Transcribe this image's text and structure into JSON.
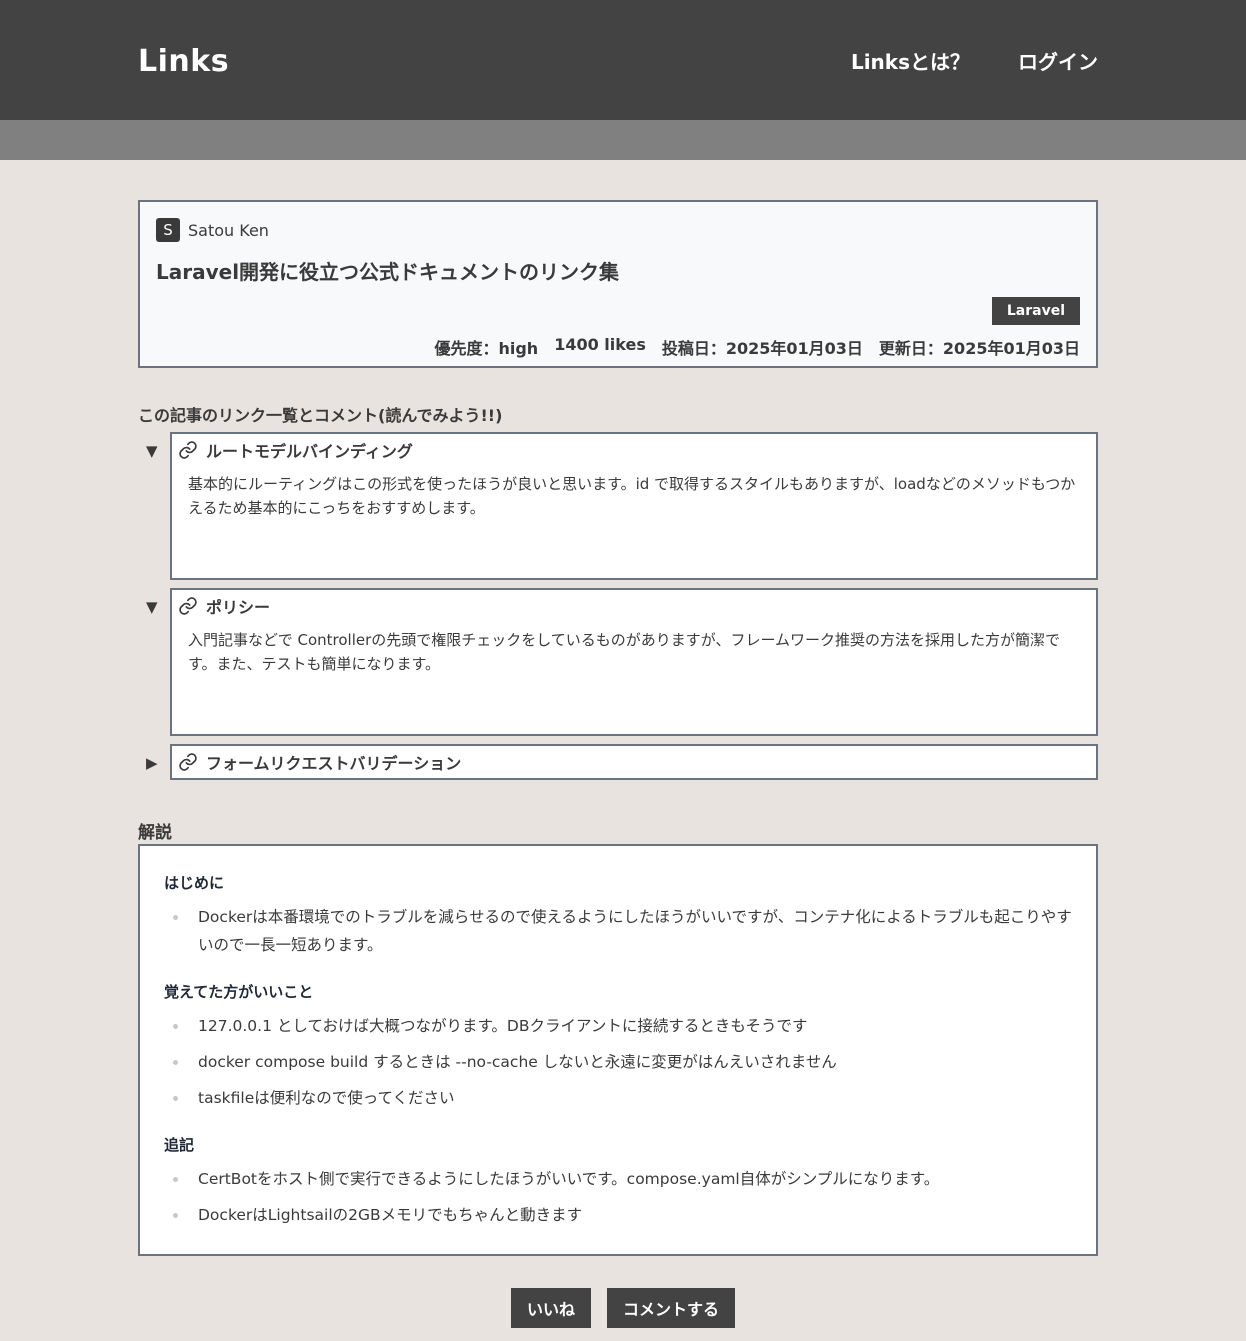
{
  "header": {
    "logo": "Links",
    "nav": {
      "about": "Linksとは？",
      "login": "ログイン"
    }
  },
  "article": {
    "author_initial": "S",
    "author_name": "Satou Ken",
    "title": "Laravel開発に役立つ公式ドキュメントのリンク集",
    "tag": "Laravel",
    "priority": "優先度：high",
    "likes": "1400 likes",
    "posted": "投稿日：2025年01月03日",
    "updated": "更新日：2025年01月03日"
  },
  "links_section": {
    "heading": "この記事のリンク一覧とコメント(読んでみよう!!)",
    "items": [
      {
        "toggle": "▼",
        "title": "ルートモデルバインディング",
        "comment": "基本的にルーティングはこの形式を使ったほうが良いと思います。id で取得するスタイルもありますが、loadなどのメソッドもつかえるため基本的にこっちをおすすめします。"
      },
      {
        "toggle": "▼",
        "title": "ポリシー",
        "comment": "入門記事などで Controllerの先頭で権限チェックをしているものがありますが、フレームワーク推奨の方法を採用した方が簡潔です。また、テストも簡単になります。"
      },
      {
        "toggle": "▶",
        "title": "フォームリクエストバリデーション"
      }
    ]
  },
  "explain": {
    "heading": "解説",
    "sections": [
      {
        "title": "はじめに",
        "items": [
          "Dockerは本番環境でのトラブルを減らせるので使えるようにしたほうがいいですが、コンテナ化によるトラブルも起こりやすいので一長一短あります。"
        ]
      },
      {
        "title": "覚えてた方がいいこと",
        "items": [
          "127.0.0.1 としておけば大概つながります。DBクライアントに接続するときもそうです",
          "docker compose build するときは --no-cache しないと永遠に変更がはんえいされません",
          "taskfileは便利なので使ってください"
        ]
      },
      {
        "title": "追記",
        "items": [
          "CertBotをホスト側で実行できるようにしたほうがいいです。compose.yaml自体がシンプルになります。",
          "DockerはLightsailの2GBメモリでもちゃんと動きます"
        ]
      }
    ]
  },
  "actions": {
    "like": "いいね",
    "comment": "コメントする"
  }
}
